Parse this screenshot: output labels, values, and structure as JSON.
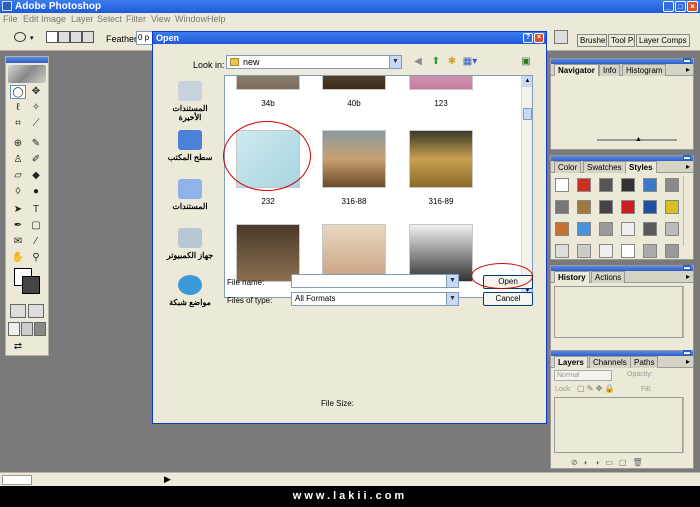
{
  "app": {
    "title": "Adobe Photoshop"
  },
  "menu": [
    "File",
    "Edit",
    "Image",
    "Layer",
    "Select",
    "Filter",
    "View",
    "Window",
    "Help"
  ],
  "options": {
    "feather_label": "Feather:",
    "feather_value": "0 p"
  },
  "palette_well": {
    "tabs": [
      "Brushes",
      "Tool Pr",
      "Layer Comps"
    ]
  },
  "panels": {
    "navigator": {
      "tabs": [
        "Navigator",
        "Info",
        "Histogram"
      ]
    },
    "styles": {
      "tabs": [
        "Color",
        "Swatches",
        "Styles"
      ]
    },
    "history": {
      "tabs": [
        "History",
        "Actions"
      ]
    },
    "layers": {
      "tabs": [
        "Layers",
        "Channels",
        "Paths"
      ],
      "blend_mode": "Normal",
      "opacity_label": "Opacity:",
      "lock_label": "Lock:",
      "fill_label": "Fill:"
    }
  },
  "dialog": {
    "title": "Open",
    "look_in_label": "Look in:",
    "look_in_value": "new",
    "places": [
      "المستندات الأخيرة",
      "سطح المكتب",
      "المستندات",
      "جهاز الكمبيوتر",
      "مواضع شبكة"
    ],
    "files": [
      {
        "name": "34b"
      },
      {
        "name": "40b"
      },
      {
        "name": "123"
      },
      {
        "name": "232"
      },
      {
        "name": "316-88"
      },
      {
        "name": "316-89"
      },
      {
        "name": ""
      },
      {
        "name": ""
      },
      {
        "name": ""
      }
    ],
    "file_name_label": "File name:",
    "file_name_value": "",
    "files_of_type_label": "Files of type:",
    "files_of_type_value": "All Formats",
    "open_button": "Open",
    "cancel_button": "Cancel",
    "file_size_label": "File Size:"
  },
  "watermark": "www.lakii.com",
  "colors": {
    "titlebar": "#1f5ad8",
    "chrome": "#ece9d8",
    "workspace": "#7a7a7a",
    "highlight": "#d40000"
  }
}
